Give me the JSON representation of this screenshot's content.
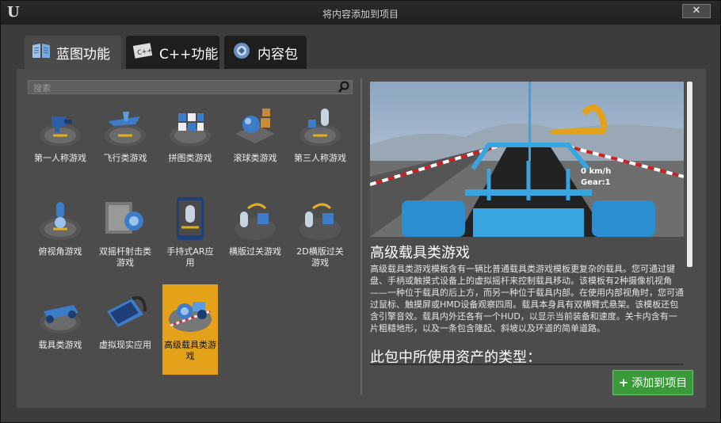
{
  "window": {
    "title": "将内容添加到项目",
    "close_label": "✕"
  },
  "tabs": [
    {
      "label": "蓝图功能",
      "active": true,
      "icon": "book-icon"
    },
    {
      "label": "C++功能",
      "active": false,
      "icon": "cpp-icon"
    },
    {
      "label": "内容包",
      "active": false,
      "icon": "content-pack-icon"
    }
  ],
  "search": {
    "placeholder": "搜索"
  },
  "templates": [
    {
      "label": "第一人称游戏",
      "icon": "first-person-icon",
      "selected": false
    },
    {
      "label": "飞行类游戏",
      "icon": "flying-icon",
      "selected": false
    },
    {
      "label": "拼图类游戏",
      "icon": "puzzle-icon",
      "selected": false
    },
    {
      "label": "滚球类游戏",
      "icon": "rolling-ball-icon",
      "selected": false
    },
    {
      "label": "第三人称游戏",
      "icon": "third-person-icon",
      "selected": false
    },
    {
      "label": "俯视角游戏",
      "icon": "top-down-icon",
      "selected": false
    },
    {
      "label": "双摇杆射击类游戏",
      "icon": "twin-stick-icon",
      "selected": false
    },
    {
      "label": "手持式AR应用",
      "icon": "handheld-ar-icon",
      "selected": false
    },
    {
      "label": "横版过关游戏",
      "icon": "side-scroller-icon",
      "selected": false
    },
    {
      "label": "2D横版过关游戏",
      "icon": "side-scroller-2d-icon",
      "selected": false
    },
    {
      "label": "载具类游戏",
      "icon": "vehicle-icon",
      "selected": false
    },
    {
      "label": "虚拟现实应用",
      "icon": "vr-icon",
      "selected": false
    },
    {
      "label": "高级载具类游戏",
      "icon": "advanced-vehicle-icon",
      "selected": true
    }
  ],
  "detail": {
    "title": "高级载具类游戏",
    "description": "高级载具类游戏模板含有一辆比普通载具类游戏模板更复杂的载具。您可通过键盘、手柄或触摸式设备上的虚拟摇杆来控制载具移动。该模板有2种摄像机视角——一种位于载具的后上方，而另一种位于载具内部。在使用内部视角时，您可通过鼠标、触摸屏或HMD设备观察四周。载具本身具有双横臂式悬架。该模板还包含引擎音效。载具内外还各有一个HUD，以显示当前装备和速度。关卡内含有一片粗糙地形，以及一条包含隆起、斜坡以及环道的简单道路。",
    "assets_title": "此包中所使用资产的类型：",
    "preview_hud": {
      "speed": "0 km/h",
      "gear": "Gear:1"
    }
  },
  "add_button": {
    "label": "添加到项目"
  },
  "colors": {
    "selected_tile": "#e3a21a",
    "add_button": "#3a9a3a"
  }
}
